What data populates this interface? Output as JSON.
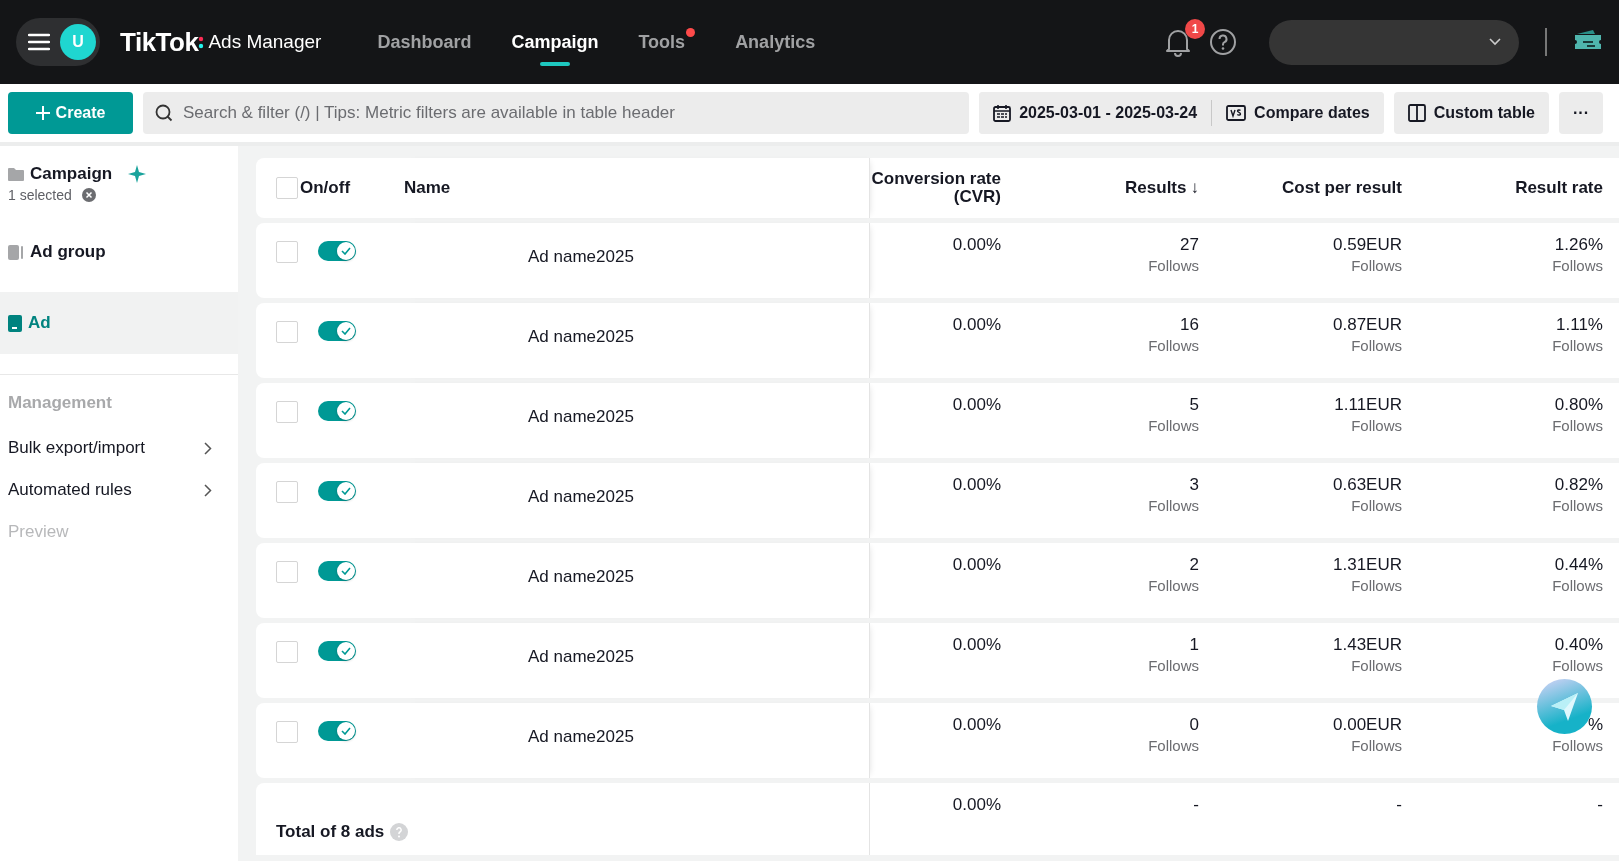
{
  "header": {
    "avatar": "U",
    "logo": "TikTok",
    "logo_suffix": "Ads Manager",
    "nav": [
      {
        "label": "Dashboard",
        "selected": false,
        "dot": false
      },
      {
        "label": "Campaign",
        "selected": true,
        "dot": false
      },
      {
        "label": "Tools",
        "selected": false,
        "dot": true
      },
      {
        "label": "Analytics",
        "selected": false,
        "dot": false
      }
    ],
    "notification_count": "1"
  },
  "toolbar": {
    "create": "Create",
    "search_placeholder": "Search & filter (/) | Tips: Metric filters are available in table header",
    "date_range": "2025-03-01 - 2025-03-24",
    "compare": "Compare dates",
    "custom_table": "Custom table",
    "more": "···"
  },
  "sidebar": {
    "levels": [
      {
        "kind": "campaign",
        "label": "Campaign",
        "sub": "1 selected",
        "selected": false
      },
      {
        "kind": "adgroup",
        "label": "Ad group",
        "selected": false
      },
      {
        "kind": "ad",
        "label": "Ad",
        "selected": true
      }
    ],
    "management": {
      "title": "Management",
      "items": [
        {
          "label": "Bulk export/import",
          "disabled": false
        },
        {
          "label": "Automated rules",
          "disabled": false
        },
        {
          "label": "Preview",
          "disabled": true
        }
      ]
    }
  },
  "table": {
    "columns": [
      {
        "label": "On/off"
      },
      {
        "label": "Name"
      },
      {
        "label": "Conversion rate (CVR)"
      },
      {
        "label": "Results",
        "sort": "↓"
      },
      {
        "label": "Cost per result"
      },
      {
        "label": "Result rate"
      }
    ],
    "all_checked": false,
    "rows": [
      {
        "checked": false,
        "on": true,
        "name": "Ad name2025",
        "cvr": "0.00%",
        "results": "27",
        "results_unit": "Follows",
        "cost": "0.59EUR",
        "cost_unit": "Follows",
        "rate": "1.26%",
        "rate_unit": "Follows"
      },
      {
        "checked": false,
        "on": true,
        "name": "Ad name2025",
        "cvr": "0.00%",
        "results": "16",
        "results_unit": "Follows",
        "cost": "0.87EUR",
        "cost_unit": "Follows",
        "rate": "1.11%",
        "rate_unit": "Follows"
      },
      {
        "checked": false,
        "on": true,
        "name": "Ad name2025",
        "cvr": "0.00%",
        "results": "5",
        "results_unit": "Follows",
        "cost": "1.11EUR",
        "cost_unit": "Follows",
        "rate": "0.80%",
        "rate_unit": "Follows"
      },
      {
        "checked": false,
        "on": true,
        "name": "Ad name2025",
        "cvr": "0.00%",
        "results": "3",
        "results_unit": "Follows",
        "cost": "0.63EUR",
        "cost_unit": "Follows",
        "rate": "0.82%",
        "rate_unit": "Follows"
      },
      {
        "checked": false,
        "on": true,
        "name": "Ad name2025",
        "cvr": "0.00%",
        "results": "2",
        "results_unit": "Follows",
        "cost": "1.31EUR",
        "cost_unit": "Follows",
        "rate": "0.44%",
        "rate_unit": "Follows"
      },
      {
        "checked": false,
        "on": true,
        "name": "Ad name2025",
        "cvr": "0.00%",
        "results": "1",
        "results_unit": "Follows",
        "cost": "1.43EUR",
        "cost_unit": "Follows",
        "rate": "0.40%",
        "rate_unit": "Follows"
      },
      {
        "checked": false,
        "on": true,
        "name": "Ad name2025",
        "cvr": "0.00%",
        "results": "0",
        "results_unit": "Follows",
        "cost": "0.00EUR",
        "cost_unit": "Follows",
        "rate": "%",
        "rate_unit": "Follows"
      }
    ],
    "total": {
      "label": "Total of 8 ads",
      "cvr": "0.00%",
      "results": "-",
      "cost": "-",
      "rate": "-"
    }
  }
}
